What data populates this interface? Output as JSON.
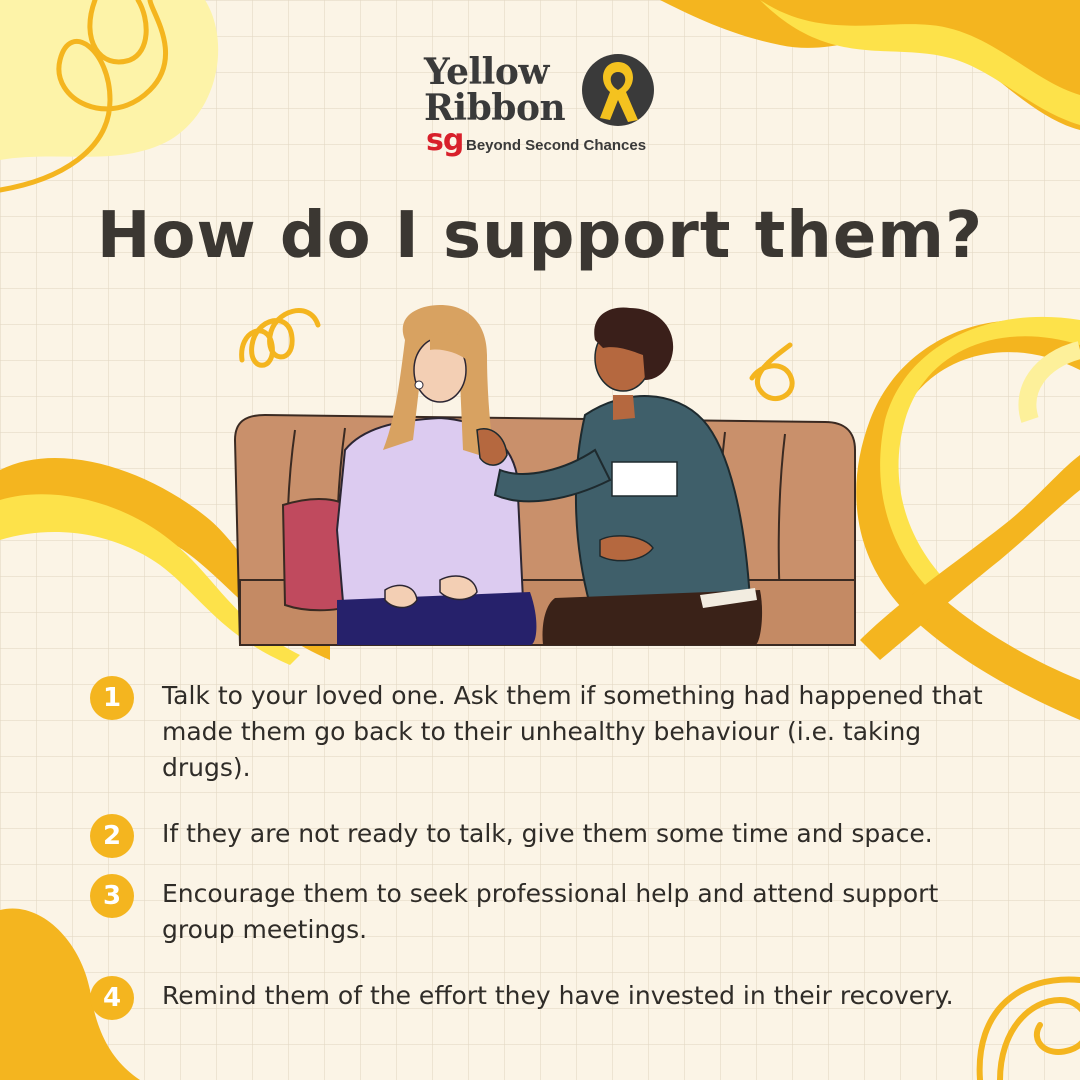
{
  "logo": {
    "word1": "Yellow",
    "word2": "Ribbon",
    "sg": "sg",
    "tagline": "Beyond Second Chances",
    "icon": "yellow-ribbon-icon"
  },
  "title": "How do I support them?",
  "illustration": "two-people-on-sofa",
  "steps": [
    {
      "number": "1",
      "text": "Talk to your loved one. Ask them if something had happened that made them go back to their unhealthy behaviour (i.e. taking drugs)."
    },
    {
      "number": "2",
      "text": "If they are not ready to talk, give them some time and space."
    },
    {
      "number": "3",
      "text": "Encourage them to seek professional help and attend support group meetings."
    },
    {
      "number": "4",
      "text": "Remind them of the effort they have invested in their recovery."
    }
  ],
  "colors": {
    "background": "#fbf4e6",
    "accent_yellow": "#f4b51f",
    "light_yellow": "#fdf09a",
    "text_dark": "#3b3732",
    "brand_red": "#d8202b"
  }
}
